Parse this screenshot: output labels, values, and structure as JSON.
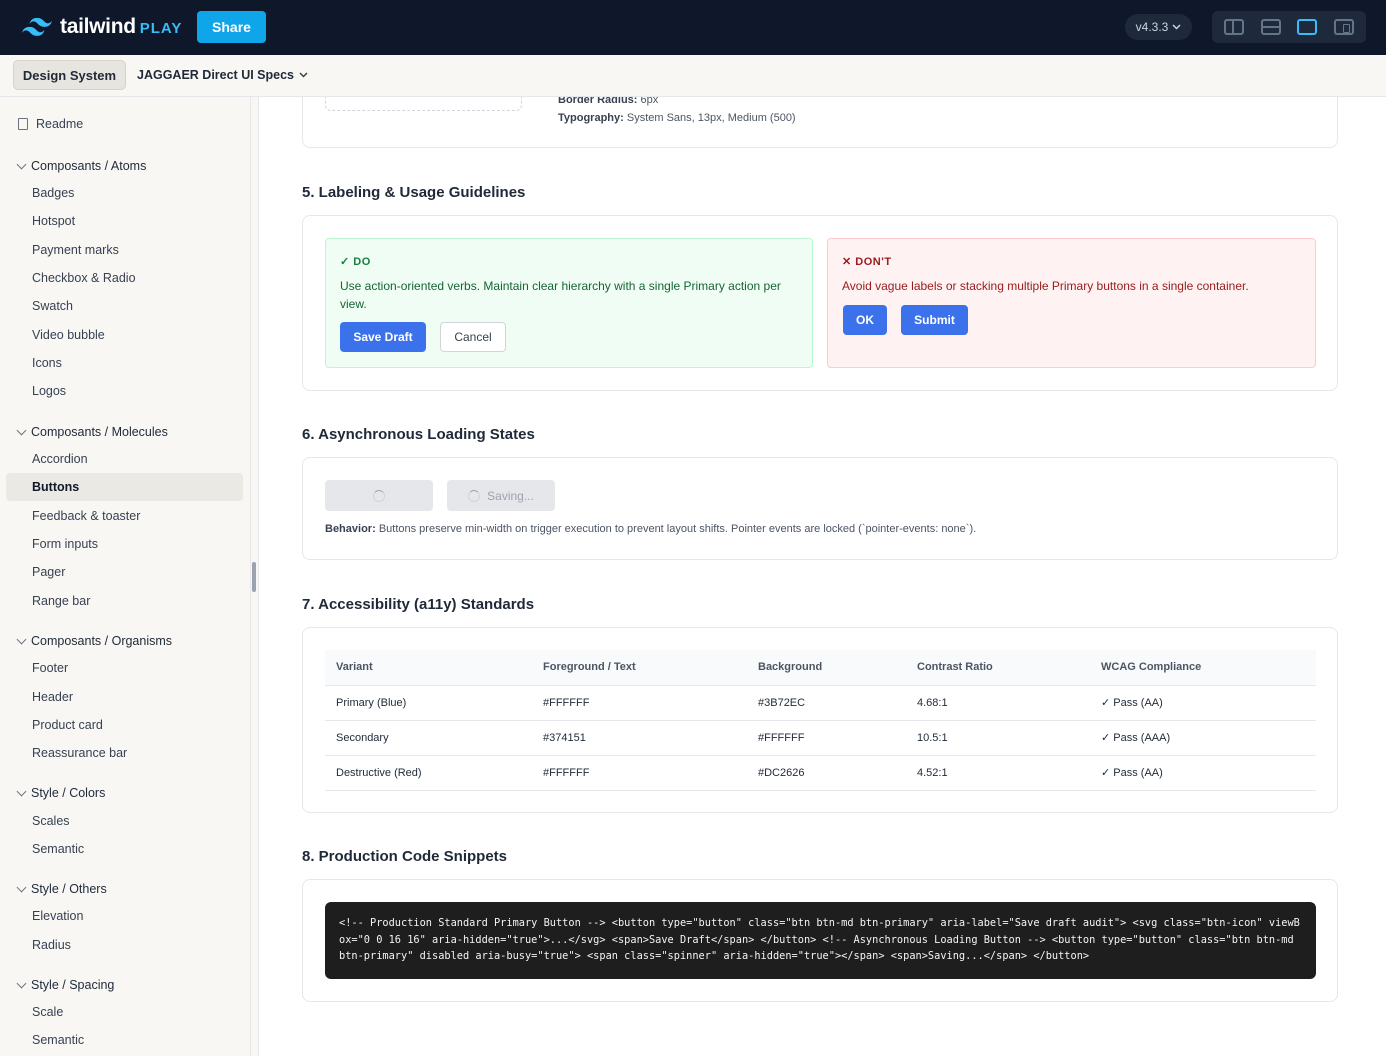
{
  "topbar": {
    "logo_text": "tailwind",
    "logo_play": "PLAY",
    "share_label": "Share",
    "version": "v4.3.3",
    "layout_icons": [
      "split-vertical-icon",
      "split-horizontal-icon",
      "preview-only-icon",
      "responsive-icon"
    ]
  },
  "subbar": {
    "design_system_label": "Design System",
    "doc_title": "JAGGAER Direct UI Specs"
  },
  "sidebar": {
    "readme": "Readme",
    "groups": [
      {
        "title": "Composants / Atoms",
        "items": [
          "Badges",
          "Hotspot",
          "Payment marks",
          "Checkbox & Radio",
          "Swatch",
          "Video bubble",
          "Icons",
          "Logos"
        ]
      },
      {
        "title": "Composants / Molecules",
        "items": [
          "Accordion",
          "Buttons",
          "Feedback & toaster",
          "Form inputs",
          "Pager",
          "Range bar"
        ]
      },
      {
        "title": "Composants / Organisms",
        "items": [
          "Footer",
          "Header",
          "Product card",
          "Reassurance bar"
        ]
      },
      {
        "title": "Style / Colors",
        "items": [
          "Scales",
          "Semantic"
        ]
      },
      {
        "title": "Style / Others",
        "items": [
          "Elevation",
          "Radius"
        ]
      },
      {
        "title": "Style / Spacing",
        "items": [
          "Scale",
          "Semantic"
        ]
      }
    ],
    "active_item": "Buttons"
  },
  "spec_top": {
    "radius_label": "Border Radius:",
    "radius_value": "6px",
    "typo_label": "Typography:",
    "typo_value": "System Sans, 13px, Medium (500)"
  },
  "section5": {
    "title": "5. Labeling & Usage Guidelines",
    "do": {
      "title": "✓ DO",
      "text": "Use action-oriented verbs. Maintain clear hierarchy with a single Primary action per view.",
      "primary_btn": "Save Draft",
      "secondary_btn": "Cancel"
    },
    "dont": {
      "title": "✕ DON'T",
      "text": "Avoid vague labels or stacking multiple Primary buttons in a single container.",
      "btn1": "OK",
      "btn2": "Submit"
    }
  },
  "section6": {
    "title": "6. Asynchronous Loading States",
    "saving_label": "Saving...",
    "behavior_label": "Behavior:",
    "behavior_text": "Buttons preserve min-width on trigger execution to prevent layout shifts. Pointer events are locked (`pointer-events: none`)."
  },
  "section7": {
    "title": "7. Accessibility (a11y) Standards",
    "headers": [
      "Variant",
      "Foreground / Text",
      "Background",
      "Contrast Ratio",
      "WCAG Compliance"
    ],
    "rows": [
      [
        "Primary (Blue)",
        "#FFFFFF",
        "#3B72EC",
        "4.68:1",
        "✓ Pass (AA)"
      ],
      [
        "Secondary",
        "#374151",
        "#FFFFFF",
        "10.5:1",
        "✓ Pass (AAA)"
      ],
      [
        "Destructive (Red)",
        "#FFFFFF",
        "#DC2626",
        "4.52:1",
        "✓ Pass (AA)"
      ]
    ]
  },
  "section8": {
    "title": "8. Production Code Snippets",
    "code": "<!-- Production Standard Primary Button --> <button type=\"button\" class=\"btn btn-md btn-primary\" aria-label=\"Save draft audit\"> <svg class=\"btn-icon\" viewBox=\"0 0 16 16\" aria-hidden=\"true\">...</svg> <span>Save Draft</span> </button> <!-- Asynchronous Loading Button --> <button type=\"button\" class=\"btn btn-md btn-primary\" disabled aria-busy=\"true\"> <span class=\"spinner\" aria-hidden=\"true\"></span> <span>Saving...</span> </button>"
  },
  "colors": {
    "topbar_bg": "#0f172a",
    "share_btn": "#0ea5e9",
    "primary": "#3B72EC",
    "do_bg": "#f0fdf4",
    "dont_bg": "#fef2f2"
  }
}
